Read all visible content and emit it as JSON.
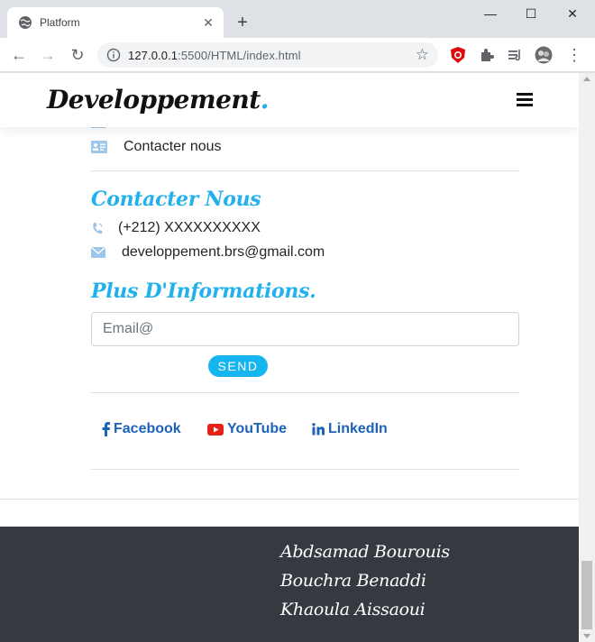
{
  "browser": {
    "tab_title": "Platform",
    "new_tab_label": "+",
    "url_host": "127.0.0.1",
    "url_rest": ":5500/HTML/index.html",
    "window_controls": {
      "minimize": "—",
      "maximize": "☐",
      "close": "✕"
    }
  },
  "site": {
    "brand": "Developpement",
    "brand_dot": ".",
    "brand_dot_color": "#1fb0e8",
    "accent_color": "#23b1ec"
  },
  "links": {
    "contact_item": "Contacter nous"
  },
  "contact": {
    "heading": "Contacter Nous",
    "phone": "(+212) XXXXXXXXXX",
    "email": "developpement.brs@gmail.com"
  },
  "newsletter": {
    "heading": "Plus D'Informations.",
    "email_placeholder": "Email@",
    "send_label": "SEND"
  },
  "social": [
    {
      "label": "Facebook",
      "icon": "facebook-icon"
    },
    {
      "label": "YouTube",
      "icon": "youtube-icon"
    },
    {
      "label": "LinkedIn",
      "icon": "linkedin-icon"
    }
  ],
  "footer": {
    "authors": [
      "Abdsamad Bourouis",
      "Bouchra Benaddi",
      "Khaoula Aissaoui"
    ]
  }
}
